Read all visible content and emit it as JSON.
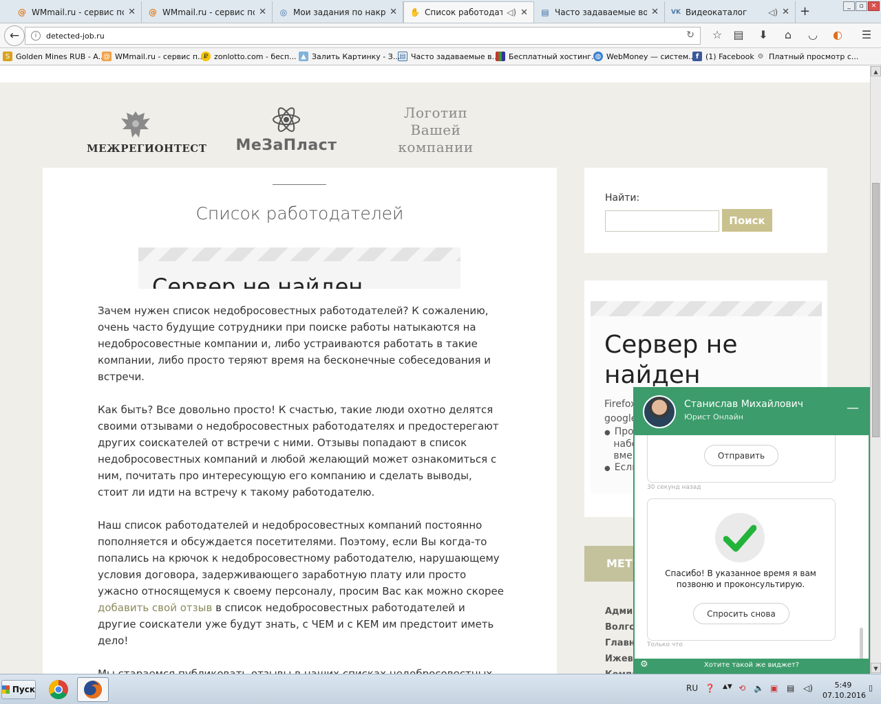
{
  "browser": {
    "tabs": [
      {
        "title": "WMmail.ru - сервис почт...",
        "icon": "wmmail-icon",
        "active": false
      },
      {
        "title": "WMmail.ru - сервис почт...",
        "icon": "wmmail-icon",
        "active": false
      },
      {
        "title": "Мои задания по накрутке",
        "icon": "target-icon",
        "active": false
      },
      {
        "title": "Список работодате...",
        "icon": "hand-icon",
        "active": true
      },
      {
        "title": "Часто задаваемые вопр...",
        "icon": "document-icon",
        "active": false
      },
      {
        "title": "Видеокаталог",
        "icon": "vk-icon",
        "active": false
      }
    ],
    "url": "detected-job.ru",
    "bookmarks": [
      "Golden Mines RUB - A...",
      "WMmail.ru - сервис п...",
      "zonlotto.com - бесп...",
      "Залить Картинку - З...",
      "Часто задаваемые в...",
      "Бесплатный хостинг...",
      "WebMoney — систем...",
      "(1) Facebook",
      "Платный просмотр с..."
    ]
  },
  "logos": {
    "mezhregiontest": "МЕЖРЕГИОНТЕСТ",
    "mezaplast": "МеЗаПласт",
    "placeholder": [
      "Логотип",
      "Вашей",
      "компании"
    ]
  },
  "main": {
    "title": "Список работодателей",
    "error_title": "Сервер не найден",
    "p1": "Зачем нужен список недобросовестных работодателей? К сожалению, очень часто будущие сотрудники при поиске работы натыкаются на недобросовестные компании и, либо устраиваются работать в такие компании, либо просто теряют время на бесконечные собеседования и встречи.",
    "p2": "Как быть? Все довольно просто! К счастью, такие люди охотно делятся своими отзывами о недобросовестных работодателях и предостерегают других соискателей от встречи с ними. Отзывы попадают в список недобросовестных компаний и любой желающий может ознакомиться с ним, почитать про интересующую его компанию и сделать выводы, стоит ли идти на встречу к такому работодателю.",
    "p3_before": "Наш список работодателей и недобросовестных компаний постоянно пополняется и обсуждается посетителями. Поэтому, если Вы когда-то попались на крючок к недобросовестному работодателю, нарушающему условия договора, задерживающего заработную плату или просто ужасно относящемуся к своему персоналу, просим Вас как можно скорее ",
    "p3_link": "добавить свой отзыв",
    "p3_after": " в список недобросовестных работодателей и другие соискатели уже будут знать, с ЧЕМ и с КЕМ им предстоит иметь дело!",
    "p4": "Мы стараемся публиковать отзывы в наших списках недобросовестных работодателей справедливо. Внимательно читаем отзыв, проверяем"
  },
  "sidebar": {
    "search_label": "Найти:",
    "search_value": "",
    "search_button": "Поиск",
    "error_title": "Сервер не найден",
    "error_small": [
      "Firefox",
      "google"
    ],
    "error_list": [
      [
        "Про",
        "набо",
        "вме"
      ],
      [
        "Если"
      ]
    ],
    "metki_title": "МЕТК",
    "metki_items": [
      "Админ",
      "Волго",
      "Главн",
      "Ижевс",
      "Компа"
    ]
  },
  "chat": {
    "agent_name": "Станислав Михайлович",
    "agent_role": "Юрист Онлайн",
    "send_button": "Отправить",
    "ts1": "30 секунд назад",
    "thanks_text": "Спасибо! В указанное время я вам позвоню и проконсультирую.",
    "ask_again_button": "Спросить снова",
    "ts2": "Только что",
    "footer_text": "Хотите такой же виджет?"
  },
  "taskbar": {
    "start_label": "Пуск",
    "lang": "RU",
    "time": "5:49",
    "date": "07.10.2016"
  }
}
